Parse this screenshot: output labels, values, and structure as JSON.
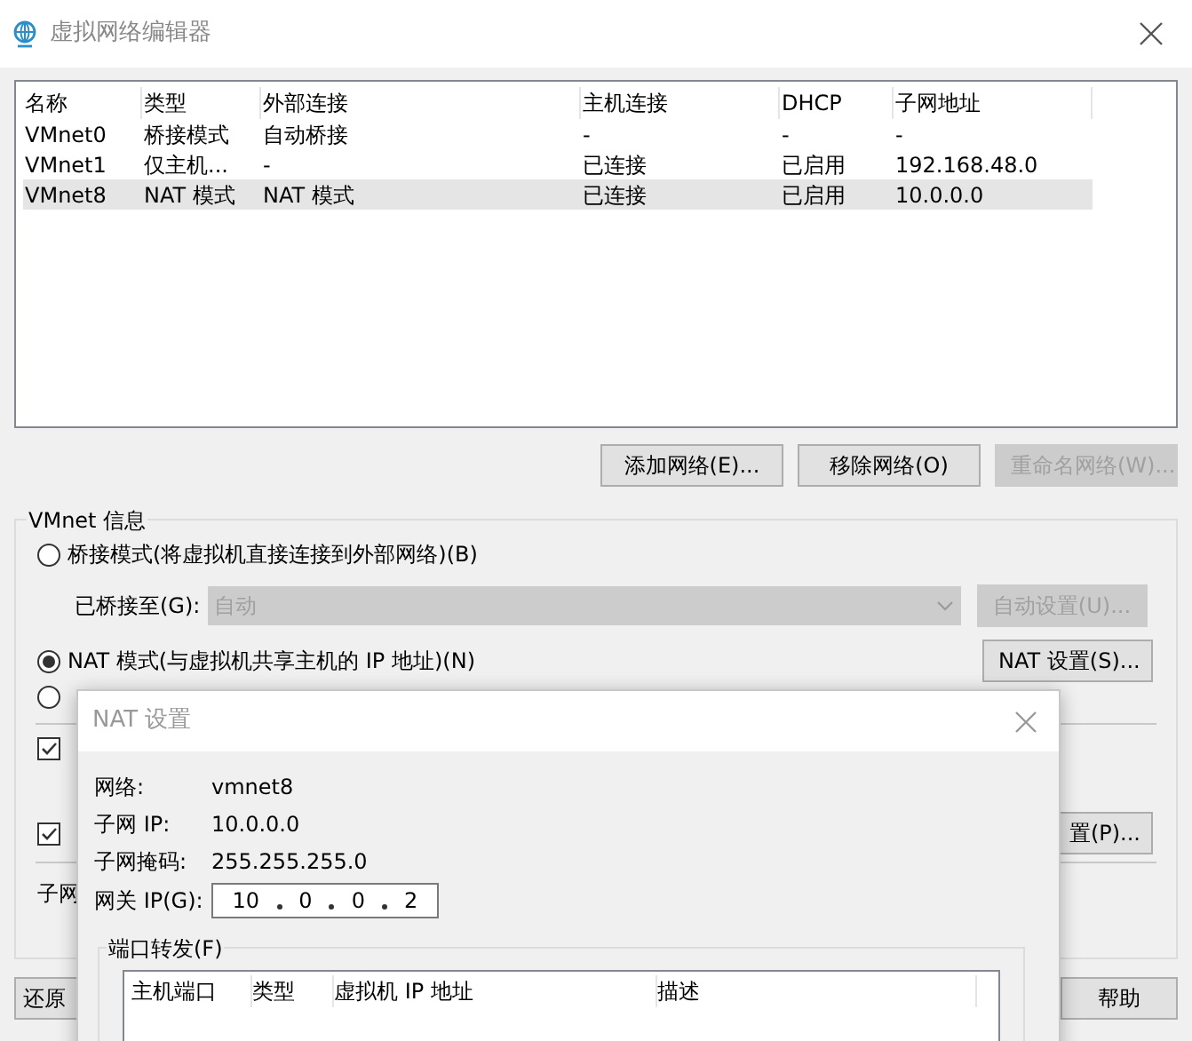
{
  "window": {
    "title": "虚拟网络编辑器"
  },
  "networks": {
    "columns": [
      "名称",
      "类型",
      "外部连接",
      "主机连接",
      "DHCP",
      "子网地址"
    ],
    "rows": [
      {
        "cells": [
          "VMnet0",
          "桥接模式",
          "自动桥接",
          "-",
          "-",
          "-"
        ],
        "selected": false
      },
      {
        "cells": [
          "VMnet1",
          "仅主机...",
          "-",
          "已连接",
          "已启用",
          "192.168.48.0"
        ],
        "selected": false
      },
      {
        "cells": [
          "VMnet8",
          "NAT 模式",
          "NAT 模式",
          "已连接",
          "已启用",
          "10.0.0.0"
        ],
        "selected": true
      }
    ]
  },
  "list_buttons": [
    {
      "label": "添加网络(E)...",
      "disabled": false
    },
    {
      "label": "移除网络(O)",
      "disabled": false
    },
    {
      "label": "重命名网络(W)...",
      "disabled": true
    }
  ],
  "vmnet_info": {
    "title": "VMnet 信息",
    "bridged_radio": {
      "label": "桥接模式(将虚拟机直接连接到外部网络)(B)",
      "selected": false
    },
    "bridged_to": {
      "label": "已桥接至(G):",
      "value": "自动",
      "disabled": true
    },
    "auto_settings_button": {
      "label": "自动设置(U)...",
      "disabled": true
    },
    "nat_radio": {
      "label": "NAT 模式(与虚拟机共享主机的 IP 地址)(N)",
      "selected": true
    },
    "nat_settings_button": {
      "label": "NAT 设置(S)...",
      "disabled": false
    },
    "host_only_radio": {
      "selected": false
    },
    "checkboxes": [
      {
        "checked": true
      },
      {
        "checked": true
      }
    ],
    "dhcp_settings_button": {
      "label": "置(P)..."
    },
    "subnet_label": "子网"
  },
  "bottom_buttons": [
    "还原",
    "帮助"
  ],
  "nat_dialog": {
    "title": "NAT 设置",
    "fields": [
      {
        "label": "网络:",
        "value": "vmnet8"
      },
      {
        "label": "子网 IP:",
        "value": "10.0.0.0"
      },
      {
        "label": "子网掩码:",
        "value": "255.255.255.0"
      }
    ],
    "gateway": {
      "label": "网关 IP(G):",
      "octets": [
        "10",
        "0",
        "0",
        "2"
      ]
    },
    "port_forwarding": {
      "title": "端口转发(F)",
      "columns": [
        "主机端口",
        "类型",
        "虚拟机 IP 地址",
        "描述"
      ]
    }
  }
}
